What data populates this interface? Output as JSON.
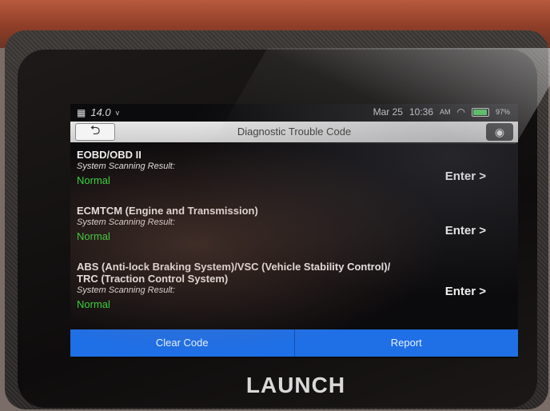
{
  "status_bar": {
    "voltage": "14.0",
    "voltage_unit": "v",
    "date": "Mar 25",
    "time": "10:36",
    "ampm": "AM",
    "battery": "97%",
    "battery_level": 0.97
  },
  "header": {
    "back_label": "⮌",
    "title": "Diagnostic Trouble Code"
  },
  "systems": [
    {
      "name": "EOBD/OBD II",
      "result_label": "System Scanning Result:",
      "result": "Normal",
      "action": "Enter >"
    },
    {
      "name": "ECMTCM (Engine and Transmission)",
      "result_label": "System Scanning Result:",
      "result": "Normal",
      "action": "Enter >"
    },
    {
      "name": "ABS (Anti-lock Braking System)/VSC (Vehicle Stability Control)/ TRC (Traction Control System)",
      "result_label": "System Scanning Result:",
      "result": "Normal",
      "action": "Enter >"
    }
  ],
  "footer": {
    "clear_code": "Clear Code",
    "report": "Report"
  },
  "device": {
    "brand": "LAUNCH"
  },
  "colors": {
    "accent": "#1f6fe6",
    "status_ok": "#2fdc3a"
  }
}
